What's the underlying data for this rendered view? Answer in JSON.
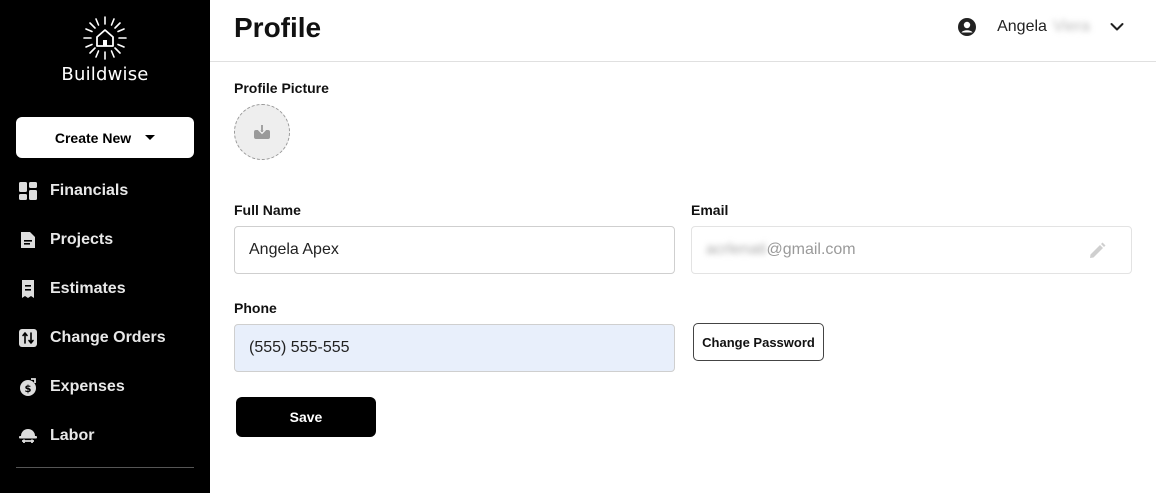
{
  "brand": {
    "name": "Buildwise",
    "logo_icon": "sunburst-house-icon"
  },
  "sidebar": {
    "create_label": "Create New",
    "items": [
      {
        "label": "Financials",
        "icon": "dashboard-grid-icon"
      },
      {
        "label": "Projects",
        "icon": "document-icon"
      },
      {
        "label": "Estimates",
        "icon": "receipt-icon"
      },
      {
        "label": "Change Orders",
        "icon": "swap-arrows-icon"
      },
      {
        "label": "Expenses",
        "icon": "money-bag-icon"
      },
      {
        "label": "Labor",
        "icon": "hard-hat-icon"
      }
    ]
  },
  "header": {
    "title": "Profile",
    "user": {
      "first_name": "Angela",
      "last_name": "Viera",
      "icon": "account-circle-icon"
    }
  },
  "form": {
    "picture_label": "Profile Picture",
    "full_name_label": "Full Name",
    "full_name_value": "Angela Apex",
    "email_label": "Email",
    "email_local": "acrlenati",
    "email_domain": "@gmail.com",
    "phone_label": "Phone",
    "phone_value": "(555) 555-555",
    "change_password_label": "Change Password",
    "save_label": "Save"
  },
  "colors": {
    "sidebar_bg": "#000000",
    "input_filled_bg": "#e8effb",
    "accent": "#000000"
  }
}
